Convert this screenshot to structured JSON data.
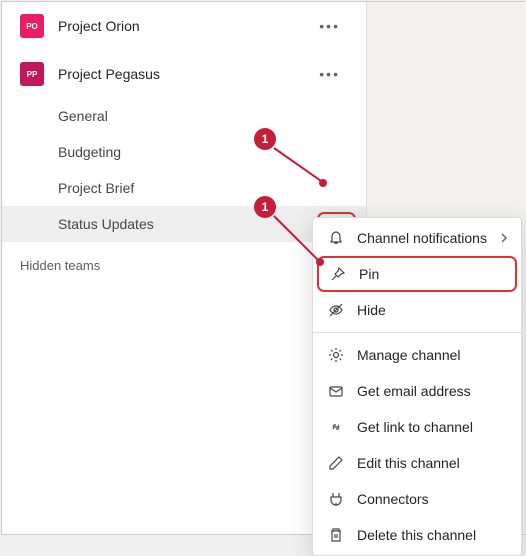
{
  "teams": [
    {
      "avatar_text": "PO",
      "avatar_color": "#e91e63",
      "name": "Project Orion"
    },
    {
      "avatar_text": "PP",
      "avatar_color": "#c2185b",
      "name": "Project Pegasus"
    }
  ],
  "channels": [
    "General",
    "Budgeting",
    "Project Brief",
    "Status Updates"
  ],
  "hidden_label": "Hidden teams",
  "menu": {
    "notifications": "Channel notifications",
    "pin": "Pin",
    "hide": "Hide",
    "manage": "Manage channel",
    "email": "Get email address",
    "link": "Get link to channel",
    "edit": "Edit this channel",
    "connectors": "Connectors",
    "delete": "Delete this channel"
  },
  "annotations": {
    "a1": "1",
    "a2": "1"
  }
}
